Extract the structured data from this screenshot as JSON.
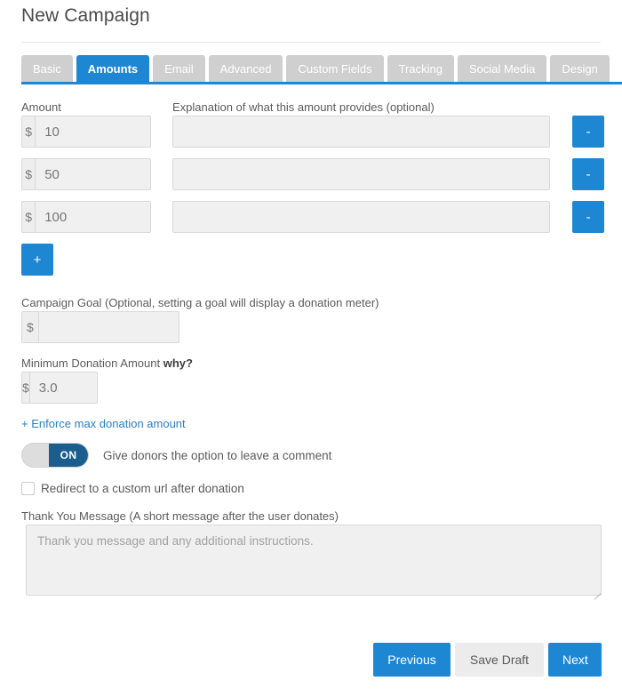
{
  "header": {
    "title": "New Campaign"
  },
  "tabs": [
    {
      "label": "Basic",
      "active": false
    },
    {
      "label": "Amounts",
      "active": true
    },
    {
      "label": "Email",
      "active": false
    },
    {
      "label": "Advanced",
      "active": false
    },
    {
      "label": "Custom Fields",
      "active": false
    },
    {
      "label": "Tracking",
      "active": false
    },
    {
      "label": "Social Media",
      "active": false
    },
    {
      "label": "Design",
      "active": false
    }
  ],
  "amounts_section": {
    "amount_column_label": "Amount",
    "explanation_column_label": "Explanation of what this amount provides (optional)",
    "currency_symbol": "$",
    "remove_button_label": "-",
    "add_button_label": "+",
    "rows": [
      {
        "amount": "10",
        "explanation": ""
      },
      {
        "amount": "50",
        "explanation": ""
      },
      {
        "amount": "100",
        "explanation": ""
      }
    ]
  },
  "campaign_goal": {
    "label": "Campaign Goal (Optional, setting a goal will display a donation meter)",
    "currency_symbol": "$",
    "value": ""
  },
  "minimum_donation": {
    "label": "Minimum Donation Amount",
    "label_emphasis": "why?",
    "currency_symbol": "$",
    "value": "3.0"
  },
  "enforce_max_link": "+ Enforce max donation amount",
  "comment_toggle": {
    "state_label": "ON",
    "description": "Give donors the option to leave a comment",
    "checked": true
  },
  "redirect_checkbox": {
    "label": "Redirect to a custom url after donation",
    "checked": false
  },
  "thank_you": {
    "label": "Thank You Message (A short message after the user donates)",
    "placeholder": "Thank you message and any additional instructions.",
    "value": ""
  },
  "footer": {
    "previous_label": "Previous",
    "save_draft_label": "Save Draft",
    "next_label": "Next"
  },
  "colors": {
    "accent_blue": "#1e87d4",
    "toggle_blue": "#1b5e8e",
    "tab_inactive": "#cfcfcf",
    "link_blue": "#2a7fc0",
    "field_bg": "#f0f0f0"
  }
}
